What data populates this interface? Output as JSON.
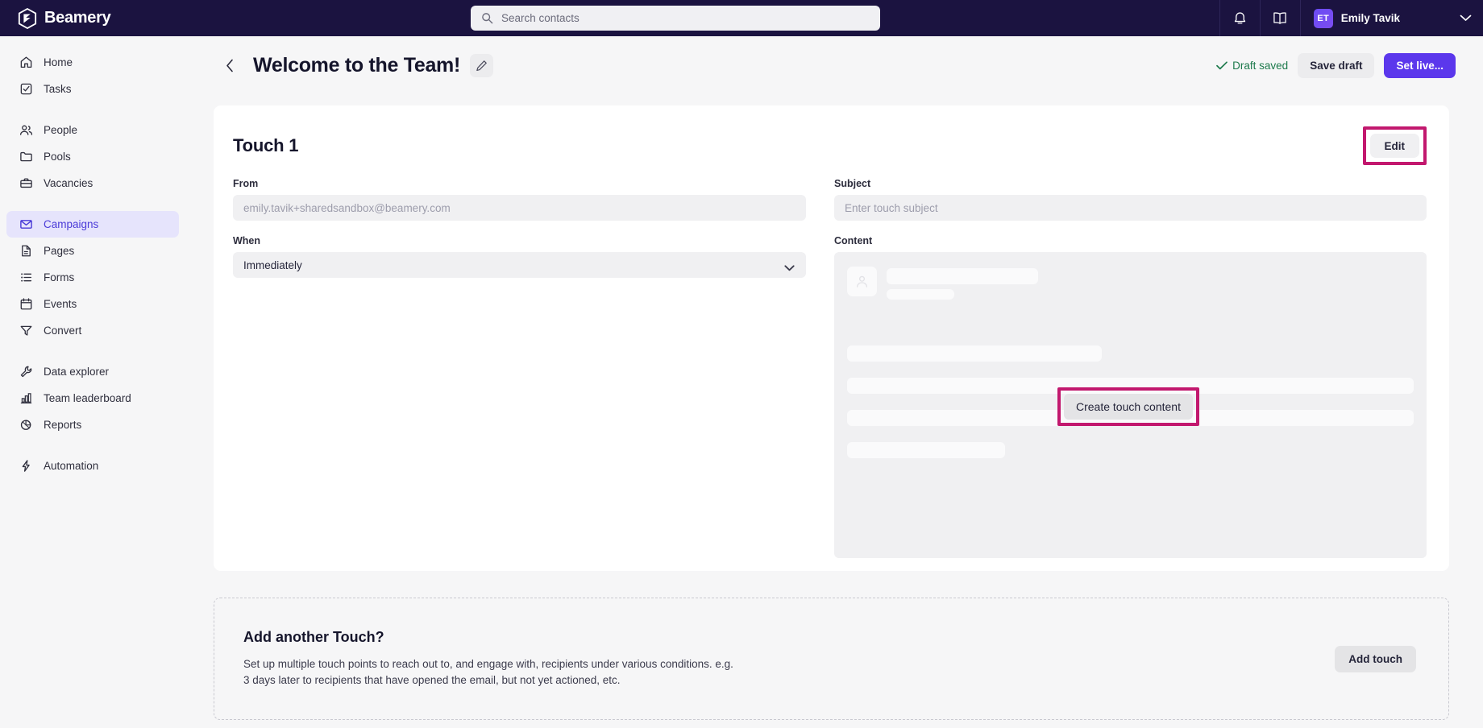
{
  "topbar": {
    "brand": "Beamery",
    "search_placeholder": "Search contacts",
    "user_initials": "ET",
    "user_name": "Emily Tavik"
  },
  "sidebar": {
    "groups": [
      {
        "items": [
          {
            "label": "Home",
            "icon": "home-icon",
            "active": false
          },
          {
            "label": "Tasks",
            "icon": "tasks-icon",
            "active": false
          }
        ]
      },
      {
        "items": [
          {
            "label": "People",
            "icon": "people-icon",
            "active": false
          },
          {
            "label": "Pools",
            "icon": "folder-icon",
            "active": false
          },
          {
            "label": "Vacancies",
            "icon": "briefcase-icon",
            "active": false
          }
        ]
      },
      {
        "items": [
          {
            "label": "Campaigns",
            "icon": "envelope-icon",
            "active": true
          },
          {
            "label": "Pages",
            "icon": "document-icon",
            "active": false
          },
          {
            "label": "Forms",
            "icon": "list-icon",
            "active": false
          },
          {
            "label": "Events",
            "icon": "calendar-icon",
            "active": false
          },
          {
            "label": "Convert",
            "icon": "funnel-icon",
            "active": false
          }
        ]
      },
      {
        "items": [
          {
            "label": "Data explorer",
            "icon": "wrench-icon",
            "active": false
          },
          {
            "label": "Team leaderboard",
            "icon": "bar-chart-icon",
            "active": false
          },
          {
            "label": "Reports",
            "icon": "pie-chart-icon",
            "active": false
          }
        ]
      },
      {
        "items": [
          {
            "label": "Automation",
            "icon": "lightning-icon",
            "active": false
          }
        ]
      }
    ]
  },
  "page_header": {
    "title": "Welcome to the Team!",
    "draft_status": "Draft saved",
    "save_draft_label": "Save draft",
    "set_live_label": "Set live..."
  },
  "touch_card": {
    "title": "Touch 1",
    "edit_label": "Edit",
    "from_label": "From",
    "from_placeholder": "emily.tavik+sharedsandbox@beamery.com",
    "from_value": "",
    "when_label": "When",
    "when_value": "Immediately",
    "subject_label": "Subject",
    "subject_placeholder": "Enter touch subject",
    "subject_value": "",
    "content_label": "Content",
    "create_content_label": "Create touch content"
  },
  "add_touch": {
    "title": "Add another Touch?",
    "description_line1": "Set up multiple touch points to reach out to, and engage with, recipients under various conditions. e.g.",
    "description_line2": "3 days later to recipients that have opened the email, but not yet actioned, etc.",
    "button_label": "Add touch"
  },
  "colors": {
    "topbar_bg": "#1b1340",
    "accent_purple": "#5b37ec",
    "active_nav_bg": "#e6e4fc",
    "active_nav_text": "#4a3bd8",
    "highlight_magenta": "#c2186e",
    "draft_green": "#1d7a4c"
  }
}
